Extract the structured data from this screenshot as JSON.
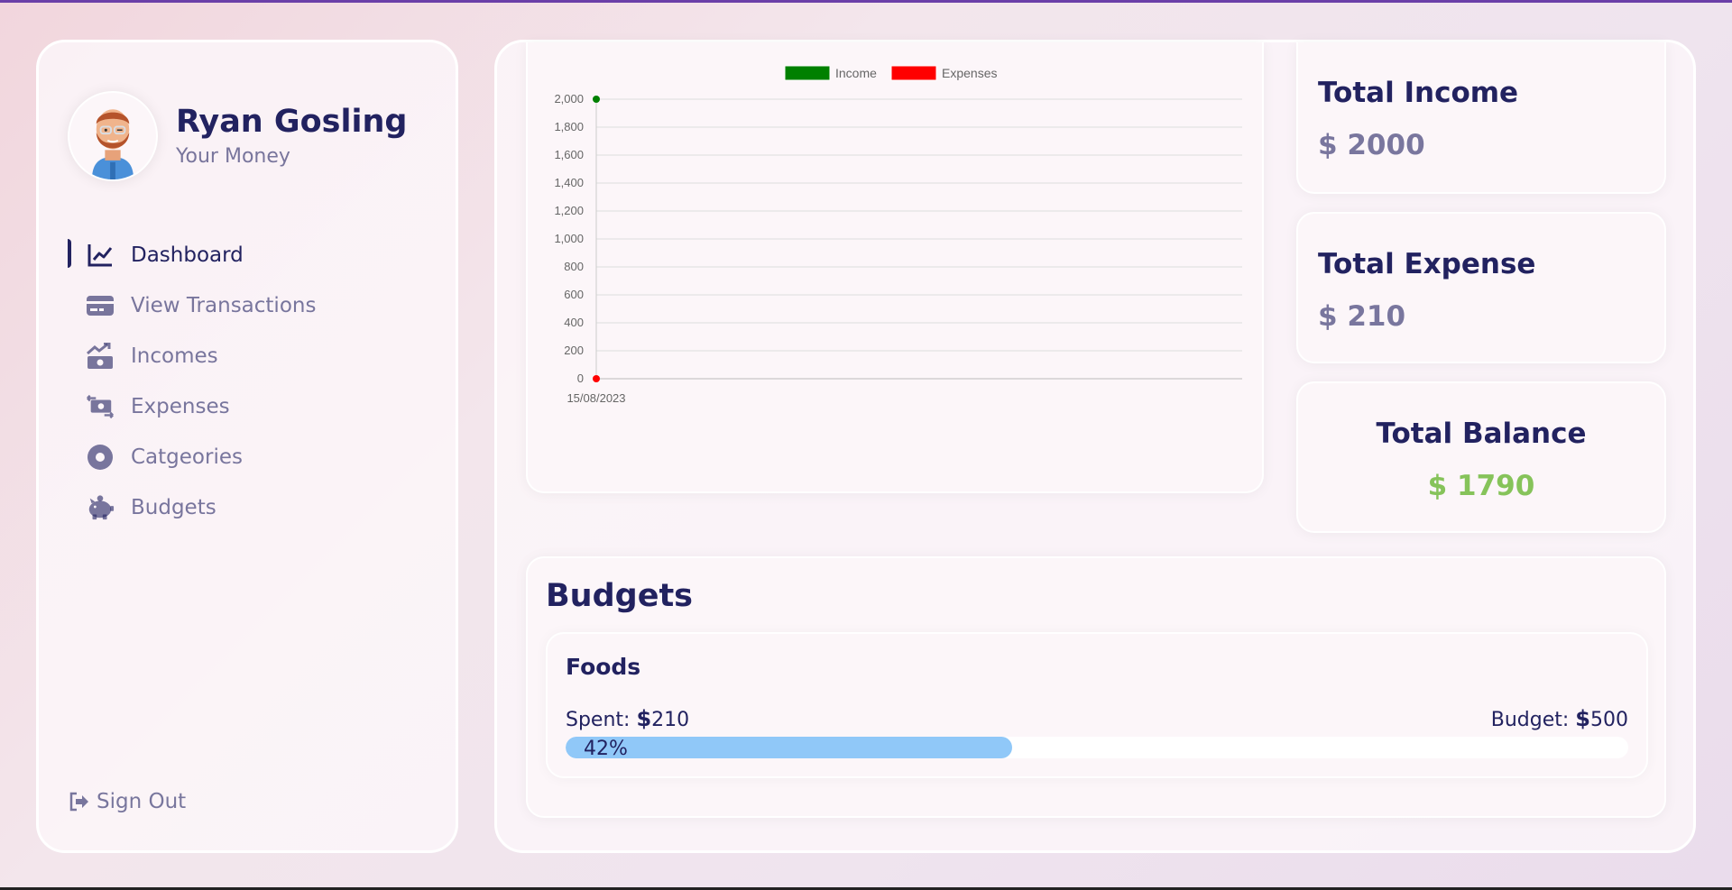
{
  "profile": {
    "name": "Ryan Gosling",
    "subtitle": "Your Money",
    "avatar_icon": "bearded-man-avatar"
  },
  "nav": {
    "items": [
      {
        "label": "Dashboard",
        "icon": "line-chart-icon",
        "active": true
      },
      {
        "label": "View Transactions",
        "icon": "credit-card-icon",
        "active": false
      },
      {
        "label": "Incomes",
        "icon": "money-trend-icon",
        "active": false
      },
      {
        "label": "Expenses",
        "icon": "money-exchange-icon",
        "active": false
      },
      {
        "label": "Catgeories",
        "icon": "circle-icon",
        "active": false
      },
      {
        "label": "Budgets",
        "icon": "piggy-bank-icon",
        "active": false
      }
    ],
    "signout_label": "Sign Out"
  },
  "chart_data": {
    "type": "line",
    "x": [
      "15/08/2023"
    ],
    "series": [
      {
        "name": "Income",
        "values": [
          2000
        ],
        "color": "#008000"
      },
      {
        "name": "Expenses",
        "values": [
          0
        ],
        "color": "#ff0000"
      }
    ],
    "ylim": [
      0,
      2000
    ],
    "yticks": [
      "0",
      "200",
      "400",
      "600",
      "800",
      "1,000",
      "1,200",
      "1,400",
      "1,600",
      "1,800",
      "2,000"
    ],
    "grid": true,
    "legend": "top"
  },
  "stats": {
    "income": {
      "title": "Total Income",
      "value": "$ 2000"
    },
    "expense": {
      "title": "Total Expense",
      "value": "$ 210"
    },
    "balance": {
      "title": "Total Balance",
      "value": "$ 1790"
    }
  },
  "budgets": {
    "title": "Budgets",
    "items": [
      {
        "name": "Foods",
        "spent_label": "Spent:",
        "currency": "$",
        "spent": "210",
        "budget_label": "Budget:",
        "budget": "500",
        "percent_label": "42%",
        "percent": 42
      }
    ]
  },
  "colors": {
    "primary": "#222260",
    "muted": "rgba(34,34,96,0.6)",
    "balance": "#86c35a",
    "progress": "#90c8f8",
    "top_border": "#6b3fa8"
  }
}
